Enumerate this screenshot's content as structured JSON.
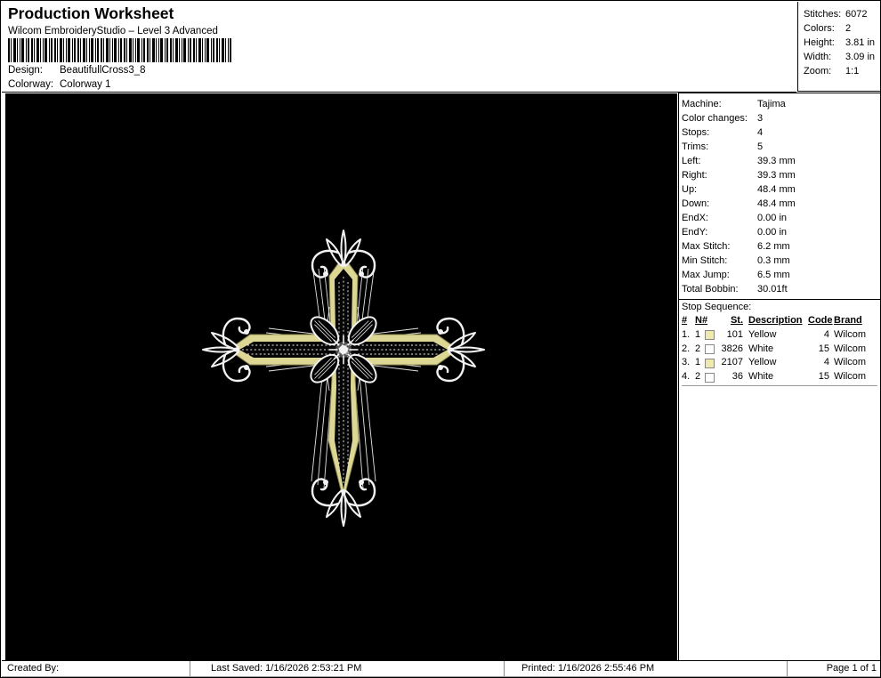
{
  "header": {
    "title": "Production Worksheet",
    "subtitle": "Wilcom EmbroideryStudio – Level 3 Advanced",
    "design_label": "Design:",
    "design_value": "BeautifullCross3_8",
    "colorway_label": "Colorway:",
    "colorway_value": "Colorway 1"
  },
  "stats": {
    "rows": [
      {
        "label": "Stitches:",
        "value": "6072"
      },
      {
        "label": "Colors:",
        "value": "2"
      },
      {
        "label": "Height:",
        "value": "3.81 in"
      },
      {
        "label": "Width:",
        "value": "3.09 in"
      },
      {
        "label": "Zoom:",
        "value": "1:1"
      }
    ]
  },
  "machine_info": {
    "rows": [
      {
        "label": "Machine:",
        "value": "Tajima"
      },
      {
        "label": "Color changes:",
        "value": "3"
      },
      {
        "label": "Stops:",
        "value": "4"
      },
      {
        "label": "Trims:",
        "value": "5"
      },
      {
        "label": "Left:",
        "value": "39.3 mm"
      },
      {
        "label": "Right:",
        "value": "39.3 mm"
      },
      {
        "label": "Up:",
        "value": "48.4 mm"
      },
      {
        "label": "Down:",
        "value": "48.4 mm"
      },
      {
        "label": "EndX:",
        "value": "0.00 in"
      },
      {
        "label": "EndY:",
        "value": "0.00 in"
      },
      {
        "label": "Max Stitch:",
        "value": "6.2 mm"
      },
      {
        "label": "Min Stitch:",
        "value": "0.3 mm"
      },
      {
        "label": "Max Jump:",
        "value": "6.5 mm"
      },
      {
        "label": "Total Bobbin:",
        "value": "30.01ft"
      }
    ]
  },
  "stop_sequence": {
    "title": "Stop Sequence:",
    "columns": [
      "#",
      "N#",
      "St.",
      "Description",
      "Code",
      "Brand"
    ],
    "rows": [
      {
        "num": "1.",
        "n": "1",
        "swatch": "#efe9ab",
        "st": "101",
        "description": "Yellow",
        "code": "4",
        "brand": "Wilcom"
      },
      {
        "num": "2.",
        "n": "2",
        "swatch": "#ffffff",
        "st": "3826",
        "description": "White",
        "code": "15",
        "brand": "Wilcom"
      },
      {
        "num": "3.",
        "n": "1",
        "swatch": "#efe9ab",
        "st": "2107",
        "description": "Yellow",
        "code": "4",
        "brand": "Wilcom"
      },
      {
        "num": "4.",
        "n": "2",
        "swatch": "#ffffff",
        "st": "36",
        "description": "White",
        "code": "15",
        "brand": "Wilcom"
      }
    ]
  },
  "footer": {
    "created_by": "Created By:",
    "last_saved": "Last Saved: 1/16/2026 2:53:21 PM",
    "printed": "Printed: 1/16/2026 2:55:46 PM",
    "page": "Page 1 of 1"
  },
  "design_preview": {
    "background": "#000000",
    "thread_yellow": "#ddd795",
    "thread_white": "#f2f2f2"
  }
}
